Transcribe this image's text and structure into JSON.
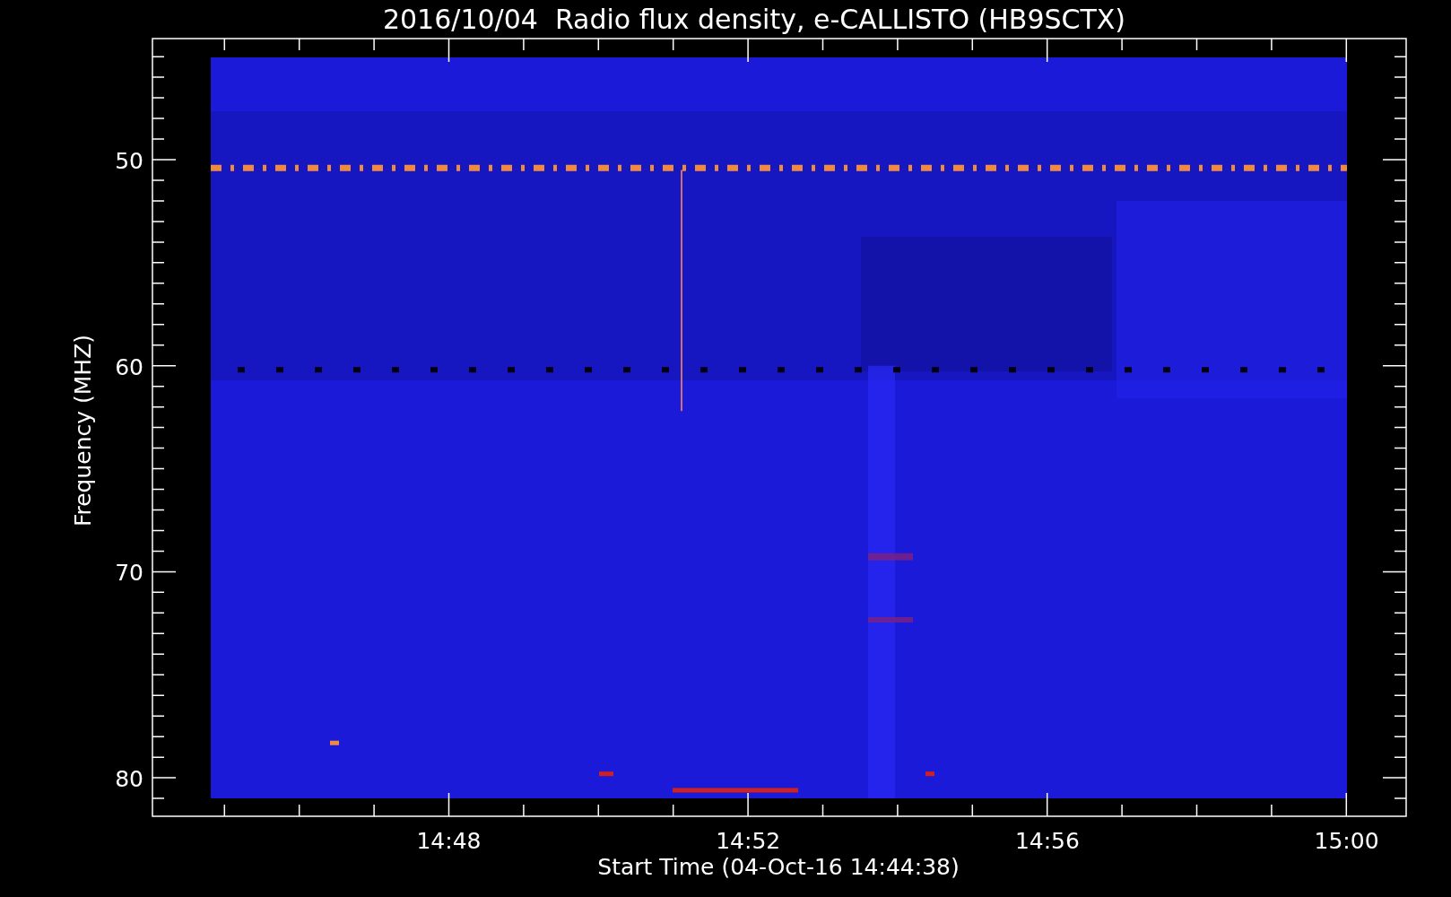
{
  "title": "2016/10/04  Radio flux density, e-CALLISTO (HB9SCTX)",
  "y_axis": {
    "label": "Frequency (MHZ)",
    "ticks": [
      "50",
      "60",
      "70",
      "80"
    ]
  },
  "x_axis": {
    "label": "Start Time (04-Oct-16 14:44:38)",
    "ticks": [
      "14:48",
      "14:52",
      "14:56",
      "15:00"
    ]
  }
}
